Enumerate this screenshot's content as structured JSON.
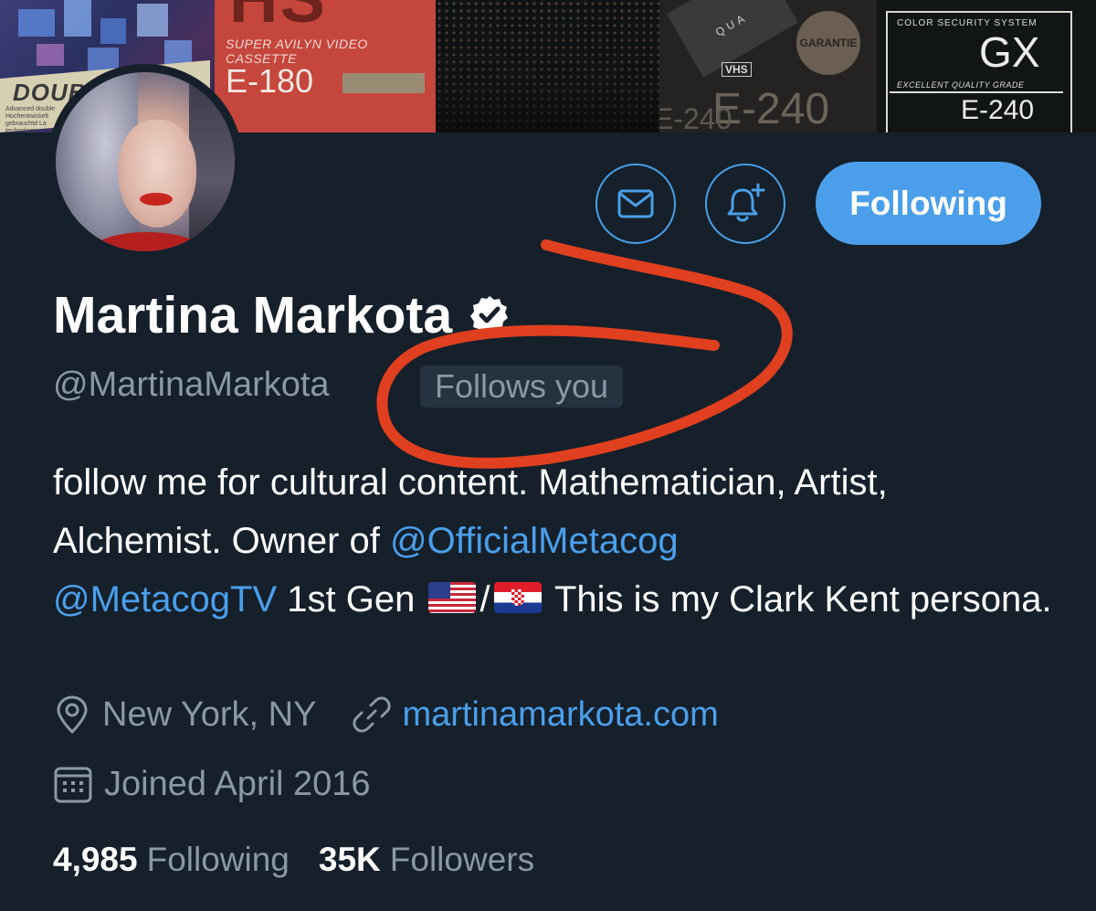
{
  "banner": {
    "tape1_brand": "DOUB",
    "tape1_small": "Advanced double Hochentwickelt gebrauchtd La technologie",
    "tape2_big": "HS",
    "tape2_line1": "SUPER AVILYN VIDEO CASSETTE",
    "tape2_line2": "E-180",
    "tape4_quality": "QUA",
    "tape4_seal": "GARANTIE",
    "tape4_vhs": "VHS",
    "tape4_e240a": "E-240",
    "tape4_e240b": "E-240",
    "tape5_css": "COLOR SECURITY SYSTEM",
    "tape5_gx": "GX",
    "tape5_eq": "EXCELLENT QUALITY GRADE",
    "tape5_e240": "E-240"
  },
  "actions": {
    "follow_label": "Following"
  },
  "profile": {
    "name": "Martina Markota",
    "handle": "@MartinaMarkota",
    "follows_you": "Follows you"
  },
  "bio": {
    "part1": "follow me for cultural content. Mathematician, Artist, Alchemist. Owner of ",
    "mention1": "@OfficialMetacog",
    "mention2": "@MetacogTV",
    "part2": " 1st Gen ",
    "slash": "/",
    "part3": " This is my Clark Kent persona."
  },
  "meta": {
    "location": "New York, NY",
    "website": "martinamarkota.com",
    "joined": "Joined April 2016"
  },
  "stats": {
    "following_count": "4,985",
    "following_label": "Following",
    "followers_count": "35K",
    "followers_label": "Followers"
  },
  "colors": {
    "background": "#15202b",
    "accent": "#4b9fea",
    "muted": "#8b98a5",
    "annotation": "#e0401f"
  },
  "icons": [
    "mail-icon",
    "bell-plus-icon",
    "verified-badge-icon",
    "location-pin-icon",
    "link-icon",
    "calendar-icon"
  ]
}
